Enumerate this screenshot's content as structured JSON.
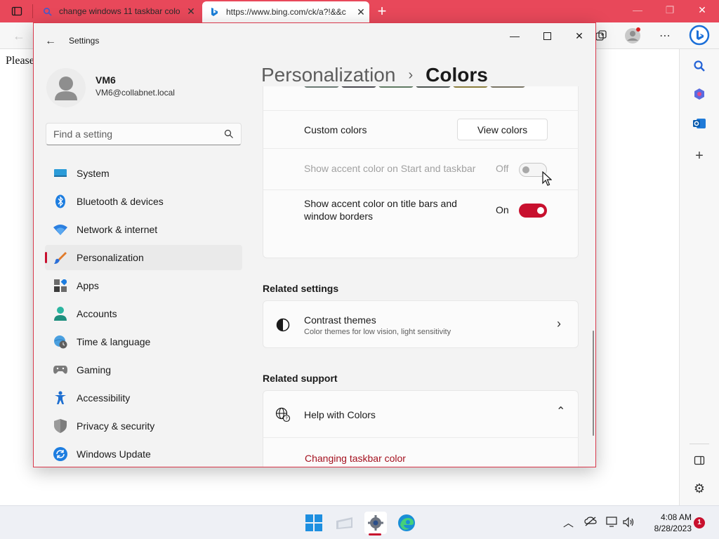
{
  "browser": {
    "tabs": [
      {
        "title": "change windows 11 taskbar colo"
      },
      {
        "title": "https://www.bing.com/ck/a?!&&c"
      }
    ],
    "page_text": "Please"
  },
  "settings": {
    "app_title": "Settings",
    "user": {
      "name": "VM6",
      "email": "VM6@collabnet.local"
    },
    "search_placeholder": "Find a setting",
    "nav": [
      {
        "label": "System",
        "icon": "system-icon"
      },
      {
        "label": "Bluetooth & devices",
        "icon": "bluetooth-icon"
      },
      {
        "label": "Network & internet",
        "icon": "wifi-icon"
      },
      {
        "label": "Personalization",
        "icon": "brush-icon",
        "selected": true
      },
      {
        "label": "Apps",
        "icon": "apps-icon"
      },
      {
        "label": "Accounts",
        "icon": "person-icon"
      },
      {
        "label": "Time & language",
        "icon": "globe-clock-icon"
      },
      {
        "label": "Gaming",
        "icon": "gamepad-icon"
      },
      {
        "label": "Accessibility",
        "icon": "accessibility-icon"
      },
      {
        "label": "Privacy & security",
        "icon": "shield-icon"
      },
      {
        "label": "Windows Update",
        "icon": "update-icon"
      }
    ],
    "breadcrumb": {
      "parent": "Personalization",
      "current": "Colors"
    },
    "swatch_colors": [
      "#6b7a74",
      "#4a4a50",
      "#5f7a62",
      "#4c5450",
      "#8a7d3c",
      "#7a7565"
    ],
    "custom_colors": {
      "label": "Custom colors",
      "button": "View colors"
    },
    "accent_start": {
      "label": "Show accent color on Start and taskbar",
      "state": "Off",
      "enabled": false
    },
    "accent_title": {
      "label_line1": "Show accent color on title bars and",
      "label_line2": "window borders",
      "state": "On",
      "enabled": true
    },
    "related_settings": {
      "heading": "Related settings",
      "contrast": {
        "title": "Contrast themes",
        "subtitle": "Color themes for low vision, light sensitivity"
      }
    },
    "related_support": {
      "heading": "Related support",
      "help": {
        "title": "Help with Colors"
      },
      "link": "Changing taskbar color"
    }
  },
  "taskbar": {
    "time": "4:08 AM",
    "date": "8/28/2023",
    "notification_count": "1"
  },
  "colors": {
    "accent": "#c8102e",
    "titlebar": "#e8485a"
  }
}
